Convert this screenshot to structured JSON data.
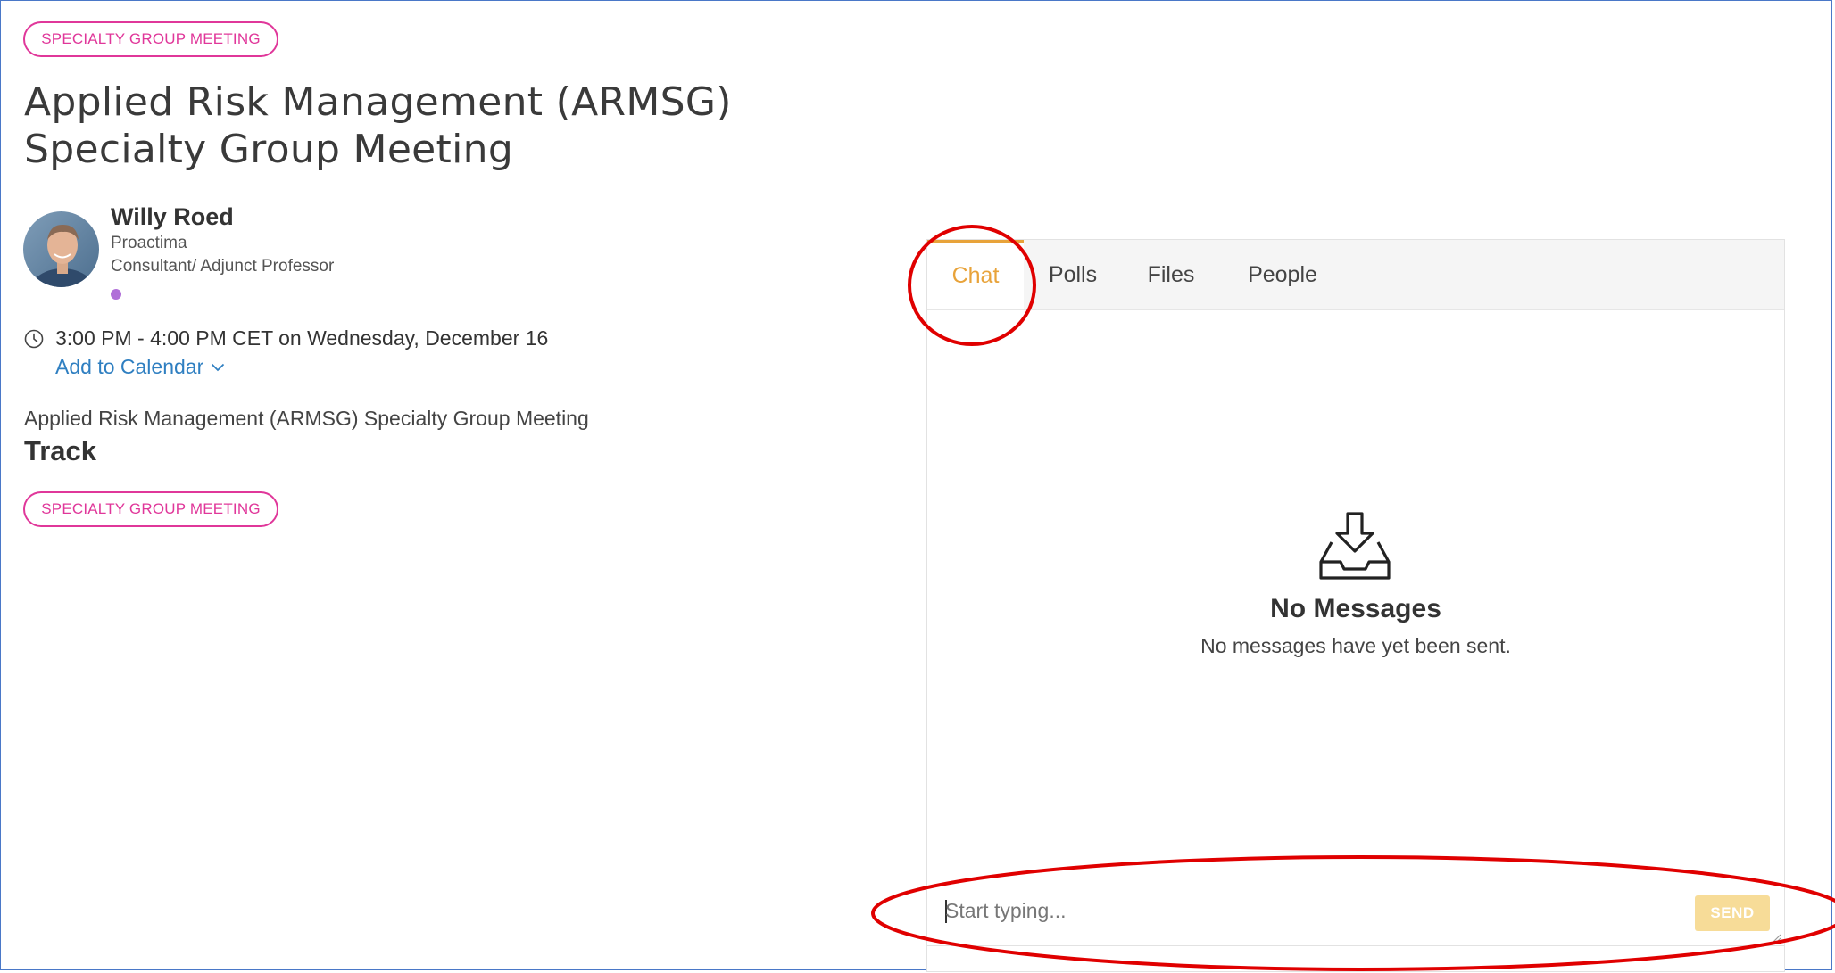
{
  "page": {
    "category_tag": "SPECIALTY GROUP MEETING",
    "title": "Applied Risk Management (ARMSG) Specialty Group Meeting"
  },
  "speaker": {
    "name": "Willy Roed",
    "organization": "Proactima",
    "role": "Consultant/ Adjunct Professor",
    "status_color": "#b06fd8"
  },
  "schedule": {
    "time_text": "3:00 PM - 4:00 PM CET on Wednesday, December 16",
    "add_to_calendar_label": "Add to Calendar"
  },
  "details": {
    "description": "Applied Risk Management (ARMSG) Specialty Group Meeting",
    "track_heading": "Track",
    "track_tag": "SPECIALTY GROUP MEETING"
  },
  "chat_panel": {
    "tabs": [
      {
        "label": "Chat",
        "active": true
      },
      {
        "label": "Polls",
        "active": false
      },
      {
        "label": "Files",
        "active": false
      },
      {
        "label": "People",
        "active": false
      }
    ],
    "empty_state": {
      "icon": "inbox-download-icon",
      "title": "No Messages",
      "text": "No messages have yet been sent."
    },
    "composer": {
      "placeholder": "Start typing...",
      "value": "",
      "send_label": "SEND"
    }
  },
  "colors": {
    "accent_pink": "#e0379a",
    "tab_active": "#e8a33a",
    "link_blue": "#2f7fc1",
    "send_disabled": "#f7dc98",
    "annotation_red": "#e00000"
  }
}
